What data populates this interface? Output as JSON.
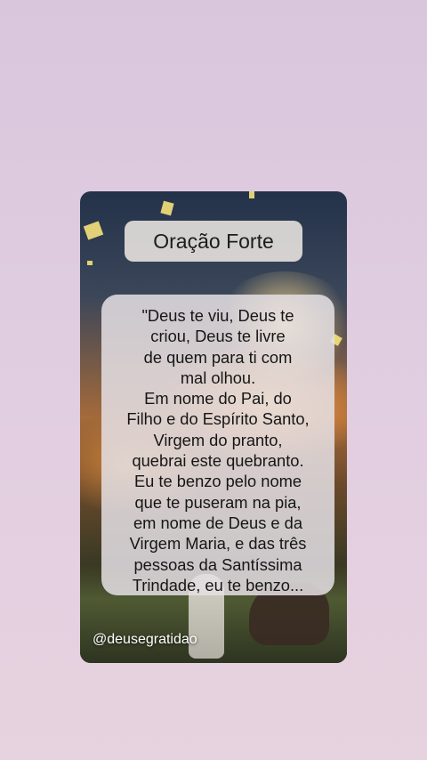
{
  "card": {
    "title": "Oração Forte",
    "prayer": "\"Deus te viu, Deus te\ncriou, Deus te livre\nde quem para ti com\nmal olhou.\nEm nome do Pai, do\nFilho e do Espírito Santo,\nVirgem do pranto,\nquebrai este quebranto.\nEu te benzo pelo nome\nque te puseram na pia,\nem nome de Deus e da\nVirgem Maria, e das três\npessoas da Santíssima\nTrindade, eu te benzo...",
    "handle": "@deusegratidao"
  },
  "colors": {
    "background": "#e0cde0",
    "box": "#e4e0e4",
    "text": "#161616"
  }
}
